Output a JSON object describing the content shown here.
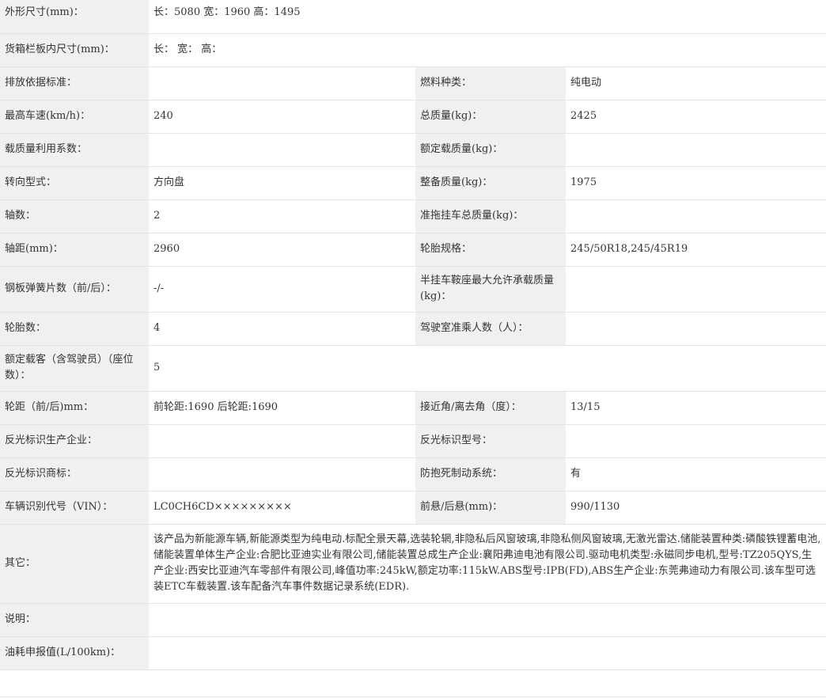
{
  "rows": [
    {
      "label": "外形尺寸(mm)：",
      "value": "长：5080 宽：1960 高：1495"
    },
    {
      "label": "货箱栏板内尺寸(mm)：",
      "value": "长： 宽： 高："
    },
    {
      "label": "排放依据标准：",
      "value": "",
      "label2": "燃料种类：",
      "value2": "纯电动"
    },
    {
      "label": "最高车速(km/h)：",
      "value": "240",
      "label2": "总质量(kg)：",
      "value2": "2425"
    },
    {
      "label": "载质量利用系数：",
      "value": "",
      "label2": "额定载质量(kg)：",
      "value2": ""
    },
    {
      "label": "转向型式：",
      "value": "方向盘",
      "label2": "整备质量(kg)：",
      "value2": "1975"
    },
    {
      "label": "轴数：",
      "value": "2",
      "label2": "准拖挂车总质量(kg)：",
      "value2": ""
    },
    {
      "label": "轴距(mm)：",
      "value": "2960",
      "label2": "轮胎规格：",
      "value2": "245/50R18,245/45R19"
    },
    {
      "label": "钢板弹簧片数（前/后）：",
      "value": "-/-",
      "label2": "半挂车鞍座最大允许承载质量(kg)：",
      "value2": ""
    },
    {
      "label": "轮胎数：",
      "value": "4",
      "label2": "驾驶室准乘人数（人）：",
      "value2": ""
    },
    {
      "label": "额定载客（含驾驶员）（座位数）：",
      "value": "5"
    },
    {
      "label": "轮距（前/后)mm：",
      "value": "前轮距:1690 后轮距:1690",
      "label2": "接近角/离去角（度）：",
      "value2": "13/15"
    },
    {
      "label": "反光标识生产企业：",
      "value": "",
      "label2": "反光标识型号：",
      "value2": ""
    },
    {
      "label": "反光标识商标：",
      "value": "",
      "label2": "防抱死制动系统：",
      "value2": "有"
    },
    {
      "label": "车辆识别代号（VIN）：",
      "value": "LC0CH6CD×××××××××",
      "label2": "前悬/后悬(mm)：",
      "value2": "990/1130"
    },
    {
      "label": "其它：",
      "value": "该产品为新能源车辆,新能源类型为纯电动.标配全景天幕,选装轮辋,非隐私后风窗玻璃,非隐私侧风窗玻璃,无激光雷达.储能装置种类:磷酸铁锂蓄电池,储能装置单体生产企业:合肥比亚迪实业有限公司,储能装置总成生产企业:襄阳弗迪电池有限公司.驱动电机类型:永磁同步电机,型号:TZ205QYS,生产企业:西安比亚迪汽车零部件有限公司,峰值功率:245kW,额定功率:115kW.ABS型号:IPB(FD),ABS生产企业:东莞弗迪动力有限公司.该车型可选装ETC车载装置.该车配备汽车事件数据记录系统(EDR)."
    },
    {
      "label": "说明：",
      "value": ""
    },
    {
      "label": "油耗申报值(L/100km)：",
      "value": ""
    }
  ]
}
